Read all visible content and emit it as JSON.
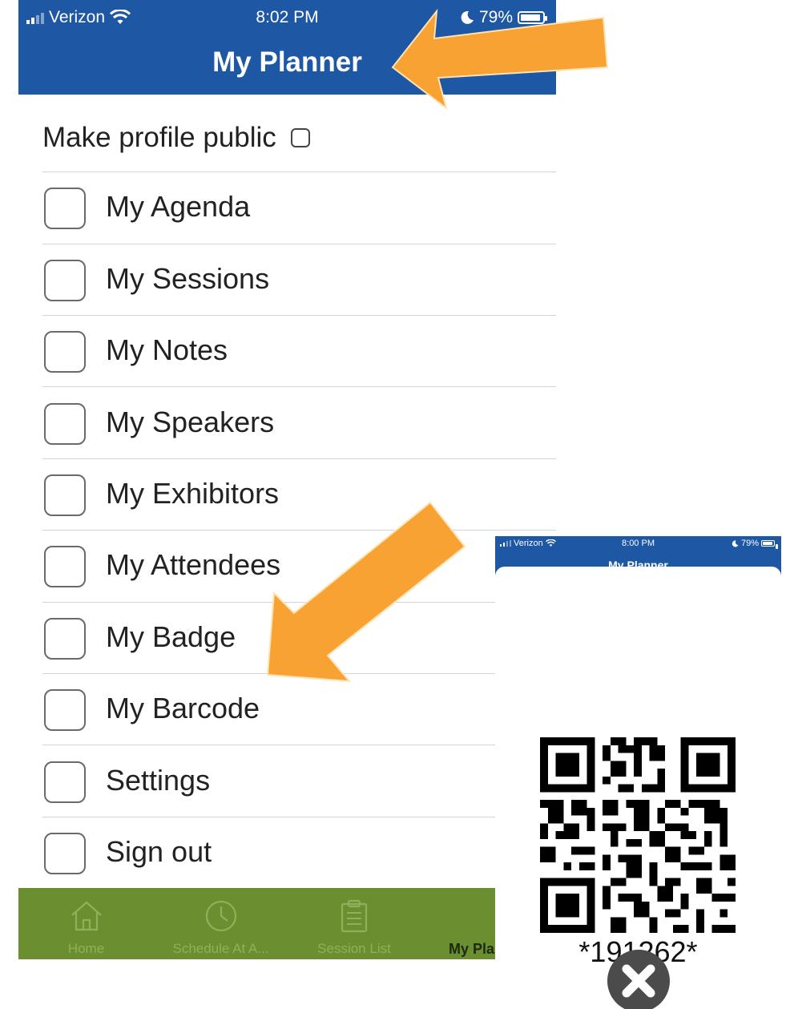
{
  "status_bar": {
    "carrier": "Verizon",
    "time": "8:02 PM",
    "battery": "79%"
  },
  "nav": {
    "title": "My Planner"
  },
  "profile": {
    "label": "Make profile public"
  },
  "menu": [
    {
      "label": "My Agenda"
    },
    {
      "label": "My Sessions"
    },
    {
      "label": "My Notes"
    },
    {
      "label": "My Speakers"
    },
    {
      "label": "My Exhibitors"
    },
    {
      "label": "My Attendees"
    },
    {
      "label": "My Badge"
    },
    {
      "label": "My Barcode"
    },
    {
      "label": "Settings"
    },
    {
      "label": "Sign out"
    }
  ],
  "tabs": [
    {
      "label": "Home",
      "icon": "home-icon"
    },
    {
      "label": "Schedule At A...",
      "icon": "clock-icon"
    },
    {
      "label": "Session List",
      "icon": "clipboard-icon"
    },
    {
      "label": "My Pla",
      "icon": "notebook-icon",
      "active": true
    }
  ],
  "overlay": {
    "status_bar": {
      "carrier": "Verizon",
      "time": "8:00 PM",
      "battery": "79%"
    },
    "title": "My Planner",
    "barcode_number": "*191262*",
    "close_icon": "close-icon"
  },
  "colors": {
    "header_blue": "#1e58a5",
    "tab_green": "#6b8f30",
    "arrow_orange": "#f7a233"
  }
}
